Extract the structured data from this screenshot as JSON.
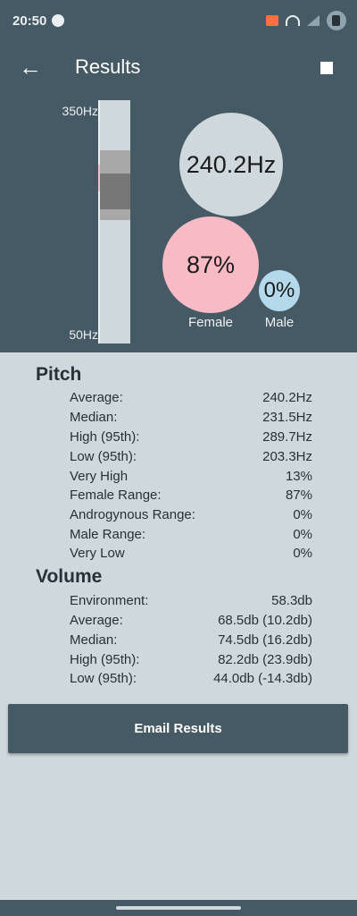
{
  "status": {
    "time": "20:50"
  },
  "app_bar": {
    "title": "Results",
    "back_icon": "←"
  },
  "visual": {
    "hz_top": "350Hz",
    "hz_bottom": "50Hz",
    "frequency": "240.2Hz",
    "female_percent": "87%",
    "male_percent": "0%",
    "female_label": "Female",
    "male_label": "Male",
    "colors": {
      "female": "#f8bbc6",
      "male": "#b3d9ea",
      "panel": "#455a64"
    }
  },
  "pitch": {
    "title": "Pitch",
    "rows": [
      {
        "label": "Average:",
        "value": "240.2Hz"
      },
      {
        "label": "Median:",
        "value": "231.5Hz"
      },
      {
        "label": "High (95th):",
        "value": "289.7Hz"
      },
      {
        "label": "Low (95th):",
        "value": "203.3Hz"
      },
      {
        "label": "Very High",
        "value": "13%"
      },
      {
        "label": "Female Range:",
        "value": "87%"
      },
      {
        "label": "Androgynous Range:",
        "value": "0%"
      },
      {
        "label": "Male Range:",
        "value": "0%"
      },
      {
        "label": "Very Low",
        "value": "0%"
      }
    ]
  },
  "volume": {
    "title": "Volume",
    "rows": [
      {
        "label": "Environment:",
        "value": "58.3db"
      },
      {
        "label": "Average:",
        "value": "68.5db (10.2db)"
      },
      {
        "label": "Median:",
        "value": "74.5db (16.2db)"
      },
      {
        "label": "High (95th):",
        "value": "82.2db (23.9db)"
      },
      {
        "label": "Low (95th):",
        "value": "44.0db (-14.3db)"
      }
    ]
  },
  "email_button": {
    "label": "Email Results"
  }
}
